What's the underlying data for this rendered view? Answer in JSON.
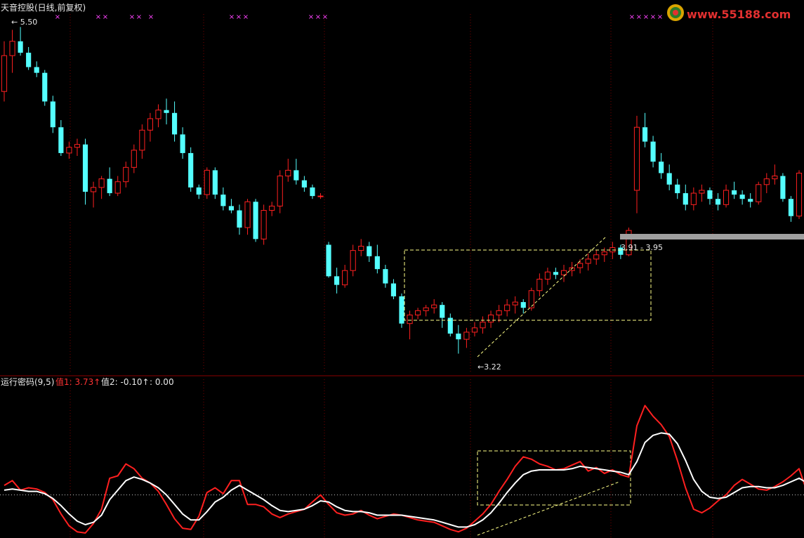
{
  "header": {
    "stock_title": "天音控股(日线,前复权)"
  },
  "indicator": {
    "name": "运行密码(9,5)",
    "value1": "值1: 3.73↑",
    "value2": "值2: -0.10↑",
    "value3": ": 0.00"
  },
  "watermark": {
    "text": "www.55188.com"
  },
  "annotations": {
    "high_label": "5.50",
    "low_label": "3.22",
    "range_label": "3.91 - 3.95"
  },
  "colors": {
    "up": "#ff2020",
    "down": "#54ffff",
    "indicator_red": "#ff2020",
    "indicator_white": "#ffffff",
    "box": "#ffff88",
    "grid_red": "#7a0000",
    "marker": "#ff44ff"
  },
  "chart_data": [
    {
      "type": "candlestick",
      "title": "天音控股(日线,前复权)",
      "ylim": [
        3.1,
        5.6
      ],
      "annotated_high": 5.5,
      "annotated_low": 3.22,
      "series": [
        {
          "name": "ohlc",
          "values": [
            [
              5.05,
              5.4,
              4.98,
              5.3
            ],
            [
              5.3,
              5.48,
              5.18,
              5.4
            ],
            [
              5.4,
              5.5,
              5.3,
              5.32
            ],
            [
              5.32,
              5.36,
              5.2,
              5.22
            ],
            [
              5.22,
              5.26,
              5.15,
              5.18
            ],
            [
              5.18,
              5.2,
              4.95,
              4.98
            ],
            [
              4.98,
              5.02,
              4.76,
              4.8
            ],
            [
              4.8,
              4.85,
              4.6,
              4.62
            ],
            [
              4.62,
              4.7,
              4.58,
              4.66
            ],
            [
              4.66,
              4.72,
              4.6,
              4.68
            ],
            [
              4.68,
              4.72,
              4.26,
              4.35
            ],
            [
              4.35,
              4.42,
              4.24,
              4.38
            ],
            [
              4.38,
              4.46,
              4.3,
              4.44
            ],
            [
              4.44,
              4.52,
              4.32,
              4.34
            ],
            [
              4.34,
              4.46,
              4.32,
              4.42
            ],
            [
              4.42,
              4.56,
              4.38,
              4.52
            ],
            [
              4.52,
              4.68,
              4.48,
              4.64
            ],
            [
              4.64,
              4.82,
              4.58,
              4.78
            ],
            [
              4.78,
              4.9,
              4.7,
              4.86
            ],
            [
              4.86,
              4.96,
              4.8,
              4.92
            ],
            [
              4.92,
              5.0,
              4.82,
              4.9
            ],
            [
              4.9,
              4.98,
              4.7,
              4.75
            ],
            [
              4.75,
              4.8,
              4.58,
              4.62
            ],
            [
              4.62,
              4.66,
              4.35,
              4.38
            ],
            [
              4.38,
              4.4,
              4.3,
              4.33
            ],
            [
              4.33,
              4.52,
              4.3,
              4.5
            ],
            [
              4.5,
              4.52,
              4.3,
              4.33
            ],
            [
              4.33,
              4.38,
              4.22,
              4.25
            ],
            [
              4.25,
              4.3,
              4.2,
              4.22
            ],
            [
              4.22,
              4.26,
              4.05,
              4.1
            ],
            [
              4.1,
              4.3,
              4.05,
              4.28
            ],
            [
              4.28,
              4.3,
              4.0,
              4.02
            ],
            [
              4.02,
              4.26,
              3.98,
              4.22
            ],
            [
              4.22,
              4.28,
              4.18,
              4.25
            ],
            [
              4.25,
              4.5,
              4.2,
              4.46
            ],
            [
              4.46,
              4.58,
              4.42,
              4.5
            ],
            [
              4.5,
              4.58,
              4.4,
              4.43
            ],
            [
              4.43,
              4.46,
              4.35,
              4.38
            ],
            [
              4.38,
              4.4,
              4.3,
              4.32
            ],
            [
              4.32,
              4.34,
              4.3,
              4.32
            ],
            [
              3.98,
              4.0,
              3.75,
              3.76
            ],
            [
              3.76,
              3.82,
              3.64,
              3.7
            ],
            [
              3.7,
              3.84,
              3.68,
              3.8
            ],
            [
              3.8,
              3.98,
              3.76,
              3.94
            ],
            [
              3.94,
              4.02,
              3.9,
              3.97
            ],
            [
              3.97,
              4.0,
              3.86,
              3.9
            ],
            [
              3.9,
              3.98,
              3.78,
              3.81
            ],
            [
              3.81,
              3.84,
              3.68,
              3.71
            ],
            [
              3.71,
              3.74,
              3.6,
              3.62
            ],
            [
              3.62,
              3.64,
              3.4,
              3.43
            ],
            [
              3.43,
              3.52,
              3.32,
              3.49
            ],
            [
              3.49,
              3.54,
              3.46,
              3.52
            ],
            [
              3.52,
              3.56,
              3.48,
              3.54
            ],
            [
              3.54,
              3.6,
              3.5,
              3.56
            ],
            [
              3.56,
              3.58,
              3.4,
              3.47
            ],
            [
              3.47,
              3.5,
              3.34,
              3.36
            ],
            [
              3.36,
              3.42,
              3.22,
              3.32
            ],
            [
              3.32,
              3.4,
              3.26,
              3.37
            ],
            [
              3.37,
              3.44,
              3.34,
              3.4
            ],
            [
              3.4,
              3.48,
              3.36,
              3.44
            ],
            [
              3.44,
              3.52,
              3.4,
              3.49
            ],
            [
              3.49,
              3.56,
              3.44,
              3.52
            ],
            [
              3.52,
              3.6,
              3.48,
              3.56
            ],
            [
              3.56,
              3.62,
              3.5,
              3.58
            ],
            [
              3.58,
              3.6,
              3.5,
              3.54
            ],
            [
              3.54,
              3.68,
              3.52,
              3.66
            ],
            [
              3.66,
              3.78,
              3.62,
              3.74
            ],
            [
              3.74,
              3.82,
              3.7,
              3.79
            ],
            [
              3.79,
              3.82,
              3.74,
              3.77
            ],
            [
              3.77,
              3.84,
              3.72,
              3.8
            ],
            [
              3.8,
              3.86,
              3.76,
              3.82
            ],
            [
              3.82,
              3.88,
              3.78,
              3.85
            ],
            [
              3.85,
              3.92,
              3.8,
              3.88
            ],
            [
              3.88,
              3.94,
              3.84,
              3.91
            ],
            [
              3.91,
              3.96,
              3.86,
              3.93
            ],
            [
              3.93,
              4.0,
              3.88,
              3.96
            ],
            [
              3.96,
              3.98,
              3.88,
              3.91
            ],
            [
              3.91,
              4.1,
              3.9,
              4.08
            ],
            [
              4.36,
              4.88,
              4.2,
              4.8
            ],
            [
              4.8,
              4.9,
              4.66,
              4.7
            ],
            [
              4.7,
              4.74,
              4.52,
              4.56
            ],
            [
              4.56,
              4.62,
              4.44,
              4.48
            ],
            [
              4.48,
              4.54,
              4.36,
              4.4
            ],
            [
              4.4,
              4.44,
              4.3,
              4.34
            ],
            [
              4.34,
              4.4,
              4.22,
              4.26
            ],
            [
              4.26,
              4.38,
              4.22,
              4.34
            ],
            [
              4.34,
              4.4,
              4.28,
              4.36
            ],
            [
              4.36,
              4.38,
              4.26,
              4.3
            ],
            [
              4.3,
              4.34,
              4.22,
              4.26
            ],
            [
              4.26,
              4.4,
              4.24,
              4.36
            ],
            [
              4.36,
              4.42,
              4.3,
              4.33
            ],
            [
              4.33,
              4.36,
              4.26,
              4.3
            ],
            [
              4.3,
              4.34,
              4.24,
              4.28
            ],
            [
              4.28,
              4.42,
              4.26,
              4.4
            ],
            [
              4.4,
              4.48,
              4.34,
              4.44
            ],
            [
              4.44,
              4.54,
              4.4,
              4.46
            ],
            [
              4.46,
              4.48,
              4.28,
              4.3
            ],
            [
              4.3,
              4.32,
              4.14,
              4.18
            ],
            [
              4.18,
              4.5,
              4.16,
              4.48
            ]
          ]
        }
      ]
    },
    {
      "type": "line",
      "title": "运行密码(9,5)",
      "ylim": [
        -3.5,
        9.0
      ],
      "series": [
        {
          "name": "值1",
          "values": [
            0.8,
            1.2,
            0.4,
            0.6,
            0.5,
            0.2,
            -0.4,
            -1.6,
            -2.6,
            -3.1,
            -3.2,
            -2.4,
            -1.2,
            1.4,
            1.6,
            2.6,
            2.2,
            1.4,
            1.0,
            0.3,
            -0.8,
            -2.0,
            -2.8,
            -2.9,
            -1.8,
            0.2,
            0.6,
            0.1,
            1.2,
            1.2,
            -0.8,
            -0.8,
            -1.0,
            -1.6,
            -1.9,
            -1.6,
            -1.4,
            -1.2,
            -0.6,
            0.0,
            -0.8,
            -1.5,
            -1.7,
            -1.6,
            -1.3,
            -1.7,
            -2.0,
            -1.8,
            -1.6,
            -1.7,
            -1.9,
            -2.1,
            -2.2,
            -2.3,
            -2.6,
            -2.9,
            -3.1,
            -2.8,
            -2.2,
            -1.6,
            -0.8,
            0.3,
            1.3,
            2.4,
            3.2,
            3.0,
            2.6,
            2.4,
            2.1,
            2.2,
            2.5,
            2.8,
            2.0,
            2.3,
            1.8,
            2.1,
            1.7,
            1.5,
            5.8,
            7.5,
            6.6,
            5.9,
            4.9,
            2.9,
            0.6,
            -1.2,
            -1.5,
            -1.1,
            -0.5,
            0.0,
            0.8,
            1.3,
            0.9,
            0.5,
            0.4,
            0.7,
            1.1,
            1.6,
            2.2,
            0.2,
            1.0
          ]
        },
        {
          "name": "值2",
          "values": [
            0.4,
            0.5,
            0.4,
            0.3,
            0.3,
            0.1,
            -0.3,
            -0.9,
            -1.6,
            -2.2,
            -2.5,
            -2.3,
            -1.7,
            -0.4,
            0.4,
            1.2,
            1.5,
            1.3,
            1.0,
            0.6,
            0.0,
            -0.8,
            -1.6,
            -2.1,
            -2.1,
            -1.4,
            -0.6,
            -0.2,
            0.4,
            0.8,
            0.4,
            0.0,
            -0.4,
            -0.9,
            -1.3,
            -1.4,
            -1.3,
            -1.2,
            -0.9,
            -0.5,
            -0.6,
            -1.0,
            -1.3,
            -1.4,
            -1.4,
            -1.5,
            -1.7,
            -1.7,
            -1.7,
            -1.7,
            -1.8,
            -1.9,
            -2.0,
            -2.1,
            -2.3,
            -2.5,
            -2.7,
            -2.7,
            -2.5,
            -2.1,
            -1.5,
            -0.7,
            0.2,
            1.0,
            1.7,
            2.0,
            2.1,
            2.1,
            2.1,
            2.1,
            2.2,
            2.4,
            2.3,
            2.2,
            2.1,
            2.0,
            1.9,
            1.7,
            2.8,
            4.4,
            5.0,
            5.2,
            5.1,
            4.3,
            2.9,
            1.3,
            0.3,
            -0.2,
            -0.3,
            -0.2,
            0.2,
            0.6,
            0.7,
            0.7,
            0.6,
            0.6,
            0.8,
            1.1,
            1.4,
            1.0,
            1.0
          ]
        }
      ],
      "reference_line": 0.0
    }
  ]
}
